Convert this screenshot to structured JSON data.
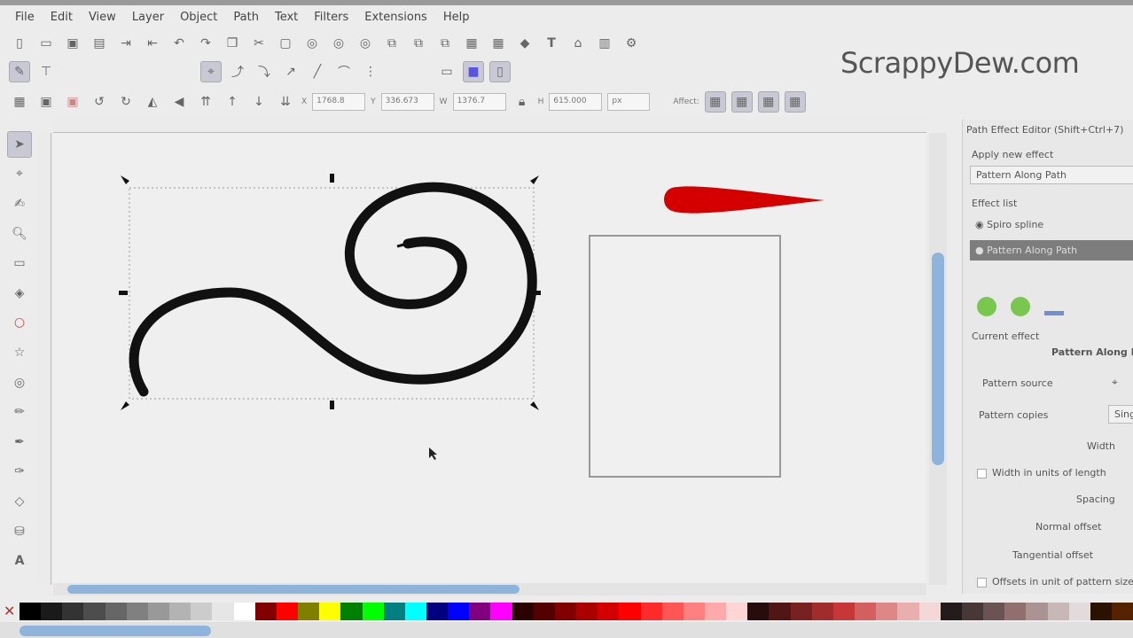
{
  "menu": [
    "File",
    "Edit",
    "View",
    "Layer",
    "Object",
    "Path",
    "Text",
    "Filters",
    "Extensions",
    "Help"
  ],
  "watermark": "ScrappyDew.com",
  "toolbar": {
    "x_label": "X",
    "x_value": "1768.8",
    "y_label": "Y",
    "y_value": "336.673",
    "w_label": "W",
    "w_value": "1376.7",
    "h_label": "H",
    "h_value": "615.000",
    "unit": "px",
    "affect_label": "Affect:"
  },
  "panel": {
    "title": "Path Effect Editor (Shift+Ctrl+7)",
    "apply_new_label": "Apply new effect",
    "apply_new_value": "Pattern Along Path",
    "effect_list_label": "Effect list",
    "effects": [
      "Spiro spline",
      "Pattern Along Path"
    ],
    "current_effect_label": "Current effect",
    "current_effect_name": "Pattern Along Path",
    "pattern_source_label": "Pattern source",
    "pattern_copies_label": "Pattern copies",
    "pattern_copies_value": "Single",
    "width_label": "Width",
    "width_units_label": "Width in units of length",
    "spacing_label": "Spacing",
    "normal_offset_label": "Normal offset",
    "tangential_offset_label": "Tangential offset",
    "offsets_unit_label": "Offsets in unit of pattern size"
  },
  "colors": {
    "accent": "#8fb4dc",
    "red_shape": "#d40000",
    "palette": [
      "#000000",
      "#1a1a1a",
      "#333333",
      "#4d4d4d",
      "#666666",
      "#808080",
      "#999999",
      "#b3b3b3",
      "#cccccc",
      "#e6e6e6",
      "#ffffff",
      "#800000",
      "#ff0000",
      "#808000",
      "#ffff00",
      "#008000",
      "#00ff00",
      "#008080",
      "#00ffff",
      "#000080",
      "#0000ff",
      "#800080",
      "#ff00ff",
      "#2b0000",
      "#550000",
      "#800000",
      "#aa0000",
      "#d40000",
      "#ff0000",
      "#ff2a2a",
      "#ff5555",
      "#ff8080",
      "#ffaaaa",
      "#ffd5d5",
      "#280b0b",
      "#501616",
      "#782121",
      "#a02c2c",
      "#c83737",
      "#d35f5f",
      "#de8787",
      "#e9afaf",
      "#f4d7d7",
      "#241c1c",
      "#483737",
      "#6c5353",
      "#916f6f",
      "#ac9393",
      "#c8b7b7",
      "#e3dbdb",
      "#2b1100",
      "#552200"
    ]
  }
}
